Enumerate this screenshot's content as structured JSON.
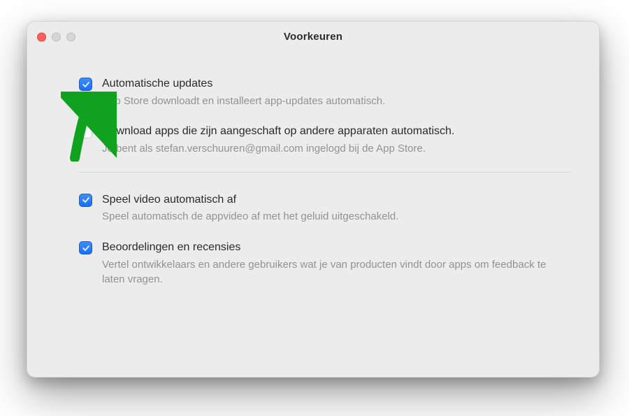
{
  "window": {
    "title": "Voorkeuren"
  },
  "settings": {
    "auto_updates": {
      "label": "Automatische updates",
      "description": "App Store downloadt en installeert app-updates automatisch.",
      "checked": true
    },
    "download_other_devices": {
      "label": "Download apps die zijn aangeschaft op andere apparaten automatisch.",
      "description": "Je bent als stefan.verschuuren@gmail.com ingelogd bij de App Store.",
      "checked": false
    },
    "autoplay_video": {
      "label": "Speel video automatisch af",
      "description": "Speel automatisch de appvideo af met het geluid uitgeschakeld.",
      "checked": true
    },
    "reviews": {
      "label": "Beoordelingen en recensies",
      "description": "Vertel ontwikkelaars en andere gebruikers wat je van producten vindt door apps om feedback te laten vragen.",
      "checked": true
    }
  },
  "annotation": {
    "arrow_color": "#10a11e"
  }
}
